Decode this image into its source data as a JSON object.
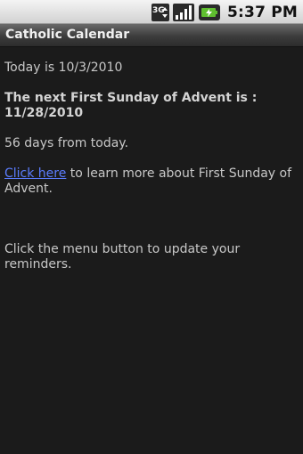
{
  "status_bar": {
    "network_label": "3G",
    "clock": "5:37 PM",
    "icons": [
      "3g-data-icon",
      "signal-strength-icon",
      "battery-charging-icon"
    ]
  },
  "app": {
    "title": "Catholic Calendar"
  },
  "main": {
    "today_text": "Today is 10/3/2010",
    "next_event_line1": "The next First Sunday of Advent is :",
    "next_event_line2": "11/28/2010",
    "days_text": "56 days from today.",
    "link_text": "Click here",
    "link_suffix": " to learn more about First Sunday of Advent.",
    "menu_hint": "Click the menu button to update your reminders."
  },
  "colors": {
    "background": "#1b1b1b",
    "text": "#c8c8c8",
    "link": "#5b7dff"
  }
}
